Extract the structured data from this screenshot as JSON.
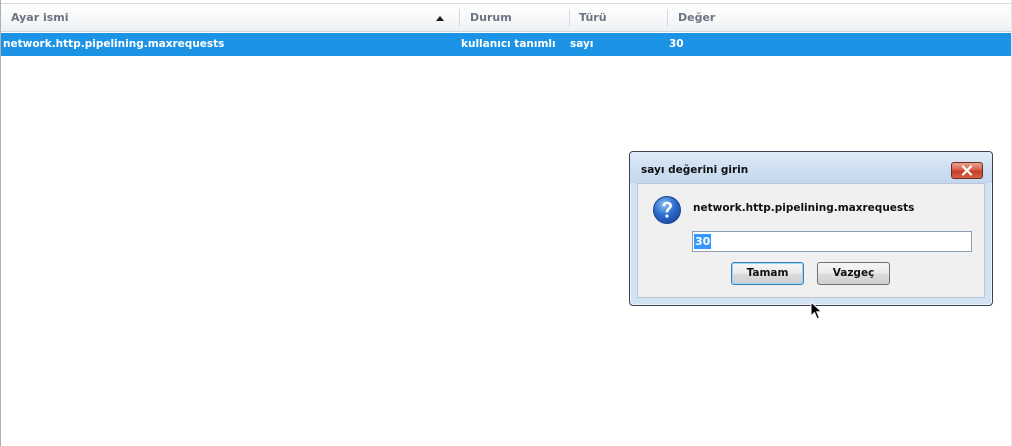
{
  "columns": {
    "name": "Ayar ismi",
    "status": "Durum",
    "type": "Türü",
    "value": "Değer"
  },
  "selected_row": {
    "name": "network.http.pipelining.maxrequests",
    "status": "kullanıcı tanımlı",
    "type": "sayı",
    "value": "30"
  },
  "dialog": {
    "title": "sayı değerini girin",
    "message": "network.http.pipelining.maxrequests",
    "input_value": "30",
    "ok_label": "Tamam",
    "cancel_label": "Vazgeç",
    "icon": "question-icon"
  },
  "colors": {
    "selection": "#1c93e5",
    "dialog_frame": "#d4e3f3",
    "close_button": "#c33d25"
  }
}
